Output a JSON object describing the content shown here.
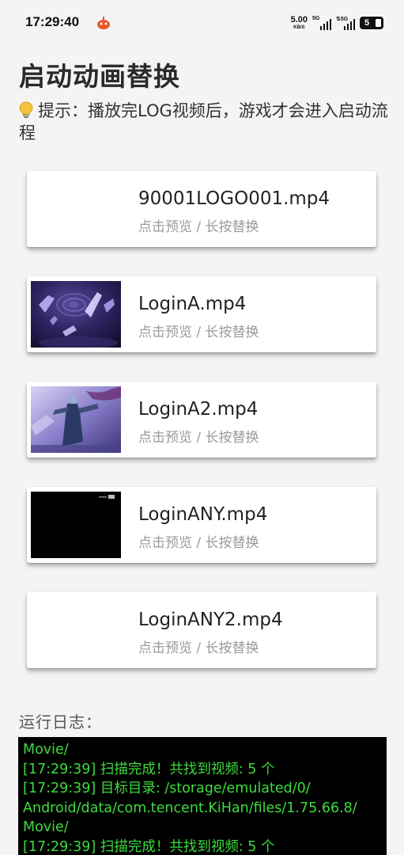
{
  "status_bar": {
    "time": "17:29:40",
    "net_speed_value": "5.00",
    "net_speed_unit": "KB/S",
    "signal1_tag": "5G",
    "signal2_tag": "⇅5G",
    "battery": "5"
  },
  "page": {
    "title": "启动动画替换",
    "hint_icon": "lightbulb-icon",
    "hint": "提示：播放完LOG视频后，游戏才会进入启动流程"
  },
  "videos": [
    {
      "name": "90001LOGO001.mp4",
      "subtitle": "点击预览 / 长按替换",
      "thumb": "blank"
    },
    {
      "name": "LoginA.mp4",
      "subtitle": "点击预览 / 长按替换",
      "thumb": "crystals"
    },
    {
      "name": "LoginA2.mp4",
      "subtitle": "点击预览 / 长按替换",
      "thumb": "figure"
    },
    {
      "name": "LoginANY.mp4",
      "subtitle": "点击预览 / 长按替换",
      "thumb": "black"
    },
    {
      "name": "LoginANY2.mp4",
      "subtitle": "点击预览 / 长按替换",
      "thumb": "blank"
    }
  ],
  "log": {
    "label": "运行日志：",
    "lines": [
      "Movie/",
      "[17:29:39] 扫描完成！共找到视频: 5 个",
      "[17:29:39] 目标目录: /storage/emulated/0/",
      "Android/data/com.tencent.KiHan/files/1.75.66.8/",
      "Movie/",
      "[17:29:39] 扫描完成！共找到视频: 5 个"
    ]
  },
  "colors": {
    "background": "#f4f4f4",
    "log_background": "#000000",
    "log_text": "#3ddc3d",
    "subtitle": "#9a9a9a"
  }
}
